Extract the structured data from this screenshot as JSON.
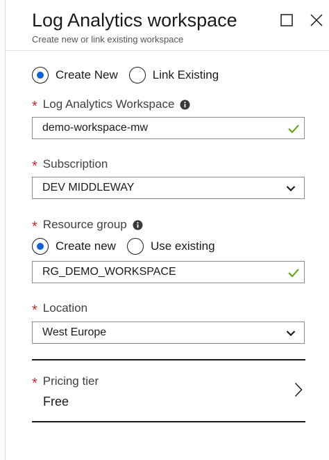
{
  "header": {
    "title": "Log Analytics workspace",
    "subtitle": "Create new or link existing workspace",
    "maximize_icon": "square-icon",
    "close_icon": "close-icon"
  },
  "mode": {
    "options": [
      {
        "label": "Create New",
        "selected": true
      },
      {
        "label": "Link Existing",
        "selected": false
      }
    ]
  },
  "workspace": {
    "label": "Log Analytics Workspace",
    "value": "demo-workspace-mw",
    "valid": true
  },
  "subscription": {
    "label": "Subscription",
    "value": "DEV MIDDLEWAY"
  },
  "resource_group": {
    "label": "Resource group",
    "options": [
      {
        "label": "Create new",
        "selected": true
      },
      {
        "label": "Use existing",
        "selected": false
      }
    ],
    "value": "RG_DEMO_WORKSPACE",
    "valid": true
  },
  "location": {
    "label": "Location",
    "value": "West Europe"
  },
  "pricing": {
    "label": "Pricing tier",
    "value": "Free"
  },
  "colors": {
    "accent": "#0b63d8",
    "required": "#c4262e",
    "valid": "#57a300"
  }
}
